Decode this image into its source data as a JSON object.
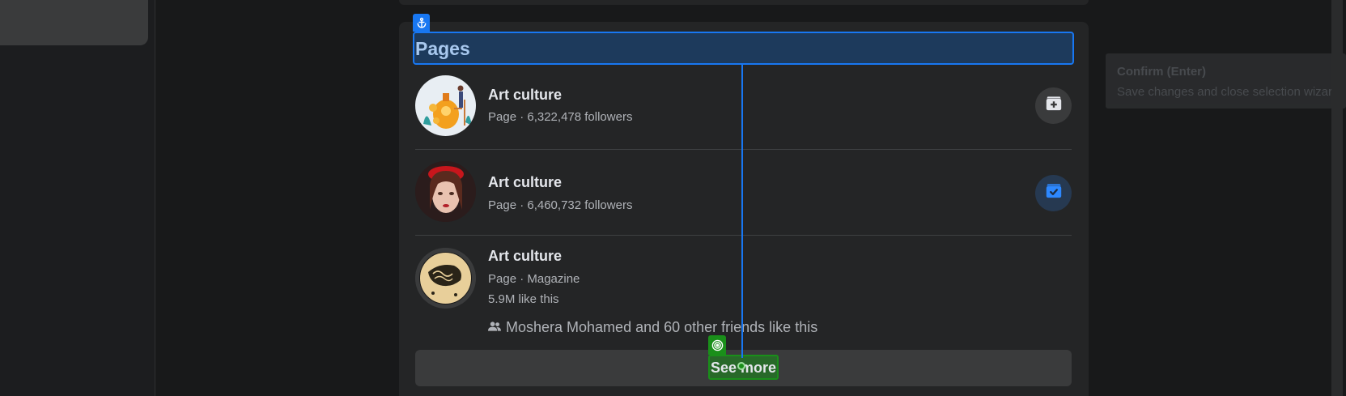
{
  "pages_section": {
    "title": "Pages",
    "items": [
      {
        "name": "Art culture",
        "meta": "Page · 6,322,478 followers",
        "action_icon": "follow-plus-icon",
        "action_state": "not-followed"
      },
      {
        "name": "Art culture",
        "meta": "Page · 6,460,732 followers",
        "action_icon": "followed-check-icon",
        "action_state": "followed"
      },
      {
        "name": "Art culture",
        "meta": "Page · Magazine",
        "likes": "5.9M like this",
        "friends": "Moshera Mohamed and 60 other friends like this"
      }
    ],
    "see_more_label": "See more"
  },
  "tooltip": {
    "title": "Confirm (Enter)",
    "description": "Save changes and close selection wizard."
  },
  "colors": {
    "page_bg": "#18191a",
    "card_bg": "#242526",
    "accent_blue": "#1877f2",
    "select_green": "#1a8f1a",
    "text_primary": "#e4e6eb",
    "text_secondary": "#b0b3b8"
  },
  "icons": [
    "anchor-icon",
    "target-icon",
    "people-icon"
  ]
}
